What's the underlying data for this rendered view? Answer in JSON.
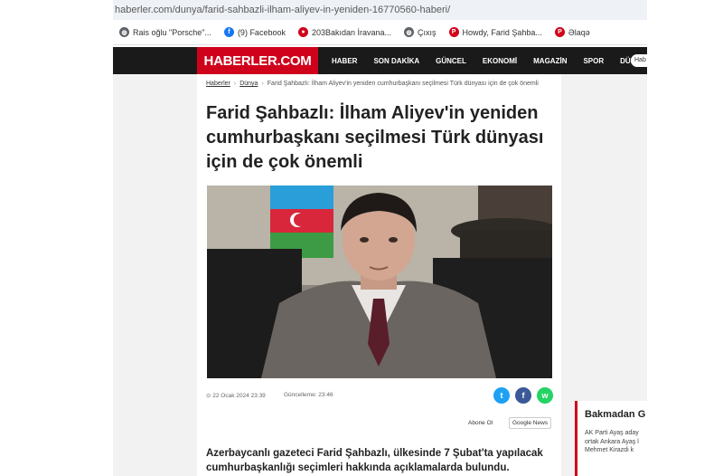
{
  "browser": {
    "url": "haberler.com/dunya/farid-sahbazli-ilham-aliyev-in-yeniden-16770560-haberi/",
    "bookmarks": [
      {
        "label": "Rais oğlu \"Porsche\"...",
        "icon": "globe-icon",
        "color": "#5f6368"
      },
      {
        "label": "(9) Facebook",
        "icon": "facebook-icon",
        "color": "#1877f2"
      },
      {
        "label": "203Bakıdan İravana...",
        "icon": "news-icon",
        "color": "#d0021b"
      },
      {
        "label": "Çıxış",
        "icon": "globe-icon",
        "color": "#5f6368"
      },
      {
        "label": "Howdy, Farid Şahba...",
        "icon": "wordpress-icon",
        "color": "#d0021b"
      },
      {
        "label": "Əlaqə",
        "icon": "wordpress-icon",
        "color": "#d0021b"
      }
    ]
  },
  "site": {
    "logo": "HABERLER.COM",
    "nav": [
      "HABER",
      "SON DAKİKA",
      "GÜNCEL",
      "EKONOMİ",
      "MAGAZİN",
      "SPOR",
      "DÜNYA"
    ],
    "search_placeholder": "Hab",
    "brand_color": "#d0021b"
  },
  "article": {
    "breadcrumb": [
      "Haberler",
      "Dünya",
      "Farid Şahbazlı: İlham Aliyev'in yeniden cumhurbaşkanı seçilmesi Türk dünyası için de çok önemli"
    ],
    "title": "Farid Şahbazlı: İlham Aliyev'in yeniden cumhurbaşkanı seçilmesi Türk dünyası için de çok önemli",
    "date": "⊙ 22 Ocak 2024 23:39",
    "updated": "Güncelleme: 23:46",
    "share": [
      {
        "name": "twitter",
        "glyph": "t",
        "color": "#1da1f2"
      },
      {
        "name": "facebook",
        "glyph": "f",
        "color": "#3b5998"
      },
      {
        "name": "whatsapp",
        "glyph": "w",
        "color": "#25d366"
      }
    ],
    "follow_label": "Abone Ol",
    "google_news_label": "Google News",
    "lead": "Azerbaycanlı gazeteci Farid Şahbazlı, ülkesinde 7 Şubat'ta yapılacak cumhurbaşkanlığı seçimleri hakkında açıklamalarda bulundu."
  },
  "sidebar": {
    "title": "Bakmadan G",
    "lines": [
      "AK Parti Ayaş aday",
      "ortak Ankara Ayaş l",
      "Mehmet Kirazdi k"
    ]
  }
}
